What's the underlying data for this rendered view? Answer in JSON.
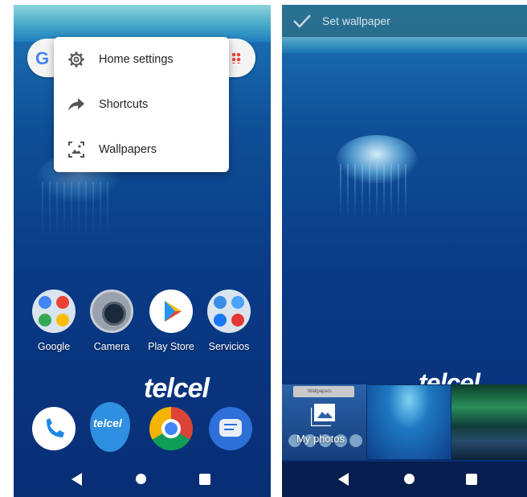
{
  "left": {
    "menu": [
      {
        "label": "Home settings",
        "icon": "gear-icon"
      },
      {
        "label": "Shortcuts",
        "icon": "shortcut-arrow-icon"
      },
      {
        "label": "Wallpapers",
        "icon": "wallpaper-icon"
      }
    ],
    "apps": [
      {
        "label": "Google",
        "icon": "google-folder-icon"
      },
      {
        "label": "Camera",
        "icon": "camera-icon"
      },
      {
        "label": "Play Store",
        "icon": "play-store-icon"
      },
      {
        "label": "Servicios",
        "icon": "servicios-folder-icon"
      }
    ],
    "dock": [
      "phone-icon",
      "telcel-icon",
      "chrome-icon",
      "messages-icon"
    ],
    "brand": "telcel",
    "brand_mark": "telcel",
    "search_logo": "G"
  },
  "right": {
    "topbar_title": "Set wallpaper",
    "my_photos_label": "My photos",
    "brand": "telcel",
    "mini_menu_label": "Wallpapers"
  },
  "colors": {
    "ocean_top": "#1e78b8",
    "ocean_bottom": "#082e74",
    "menu_bg": "#ffffff",
    "accent_chrome": "#db4437"
  }
}
